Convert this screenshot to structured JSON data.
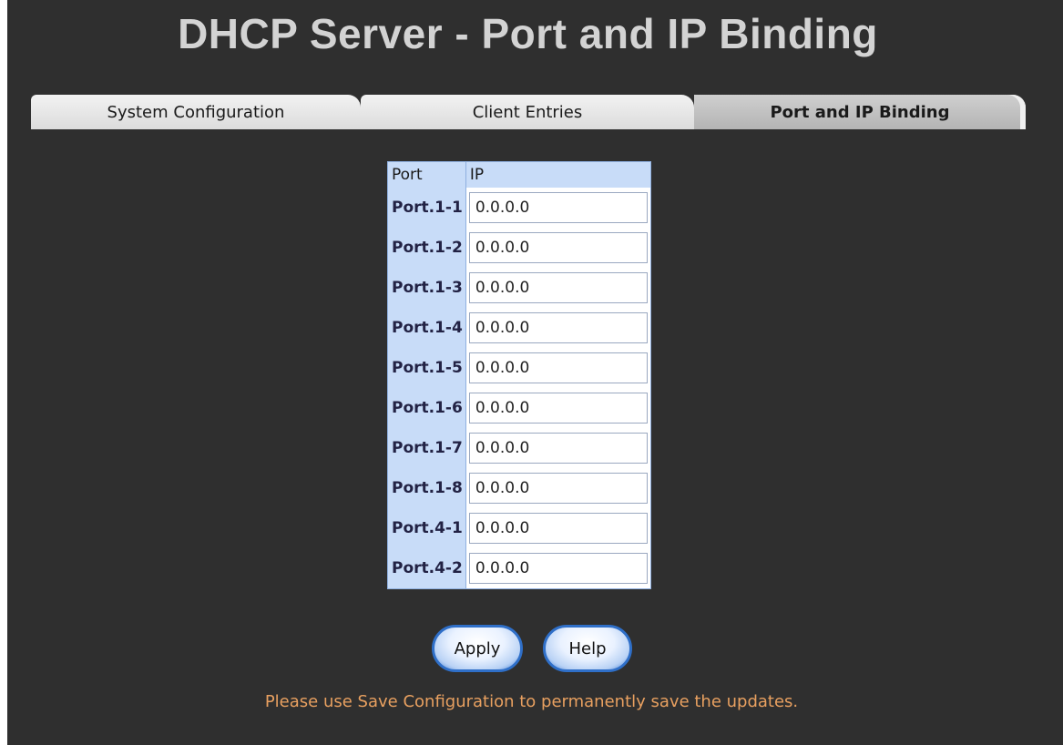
{
  "title": "DHCP Server - Port and IP Binding",
  "tabs": [
    {
      "label": "System Configuration"
    },
    {
      "label": "Client Entries"
    },
    {
      "label": "Port and IP Binding"
    }
  ],
  "table": {
    "headers": {
      "port": "Port",
      "ip": "IP"
    },
    "rows": [
      {
        "port": "Port.1-1",
        "ip": "0.0.0.0"
      },
      {
        "port": "Port.1-2",
        "ip": "0.0.0.0"
      },
      {
        "port": "Port.1-3",
        "ip": "0.0.0.0"
      },
      {
        "port": "Port.1-4",
        "ip": "0.0.0.0"
      },
      {
        "port": "Port.1-5",
        "ip": "0.0.0.0"
      },
      {
        "port": "Port.1-6",
        "ip": "0.0.0.0"
      },
      {
        "port": "Port.1-7",
        "ip": "0.0.0.0"
      },
      {
        "port": "Port.1-8",
        "ip": "0.0.0.0"
      },
      {
        "port": "Port.4-1",
        "ip": "0.0.0.0"
      },
      {
        "port": "Port.4-2",
        "ip": "0.0.0.0"
      }
    ]
  },
  "buttons": {
    "apply": "Apply",
    "help": "Help"
  },
  "note": "Please use Save Configuration to permanently save the updates.",
  "colors": {
    "background": "#2f2f2f",
    "title": "#d3d3d3",
    "table_header": "#c8dcf8",
    "note": "#e8a060"
  }
}
